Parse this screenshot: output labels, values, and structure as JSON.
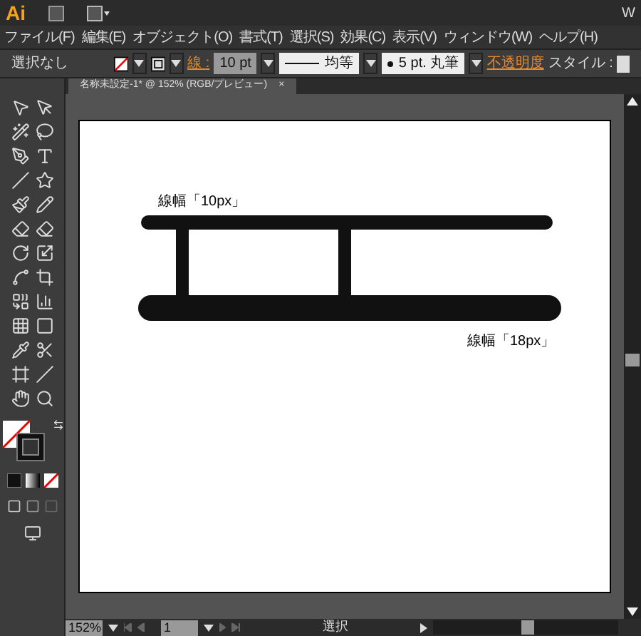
{
  "app": {
    "logo": "Ai",
    "cut_text": "W"
  },
  "menu": [
    "ファイル(F)",
    "編集(E)",
    "オブジェクト(O)",
    "書式(T)",
    "選択(S)",
    "効果(C)",
    "表示(V)",
    "ウィンドウ(W)",
    "ヘルプ(H)"
  ],
  "control_bar": {
    "selection": "選択なし",
    "stroke_label": "線 :",
    "stroke_weight": "10 pt",
    "profile": "均等",
    "brush": "5 pt. 丸筆",
    "opacity": "不透明度",
    "style_label": "スタイル :"
  },
  "document_tab": {
    "title": "名称未設定-1* @ 152% (RGB/プレビュー)",
    "close": "×"
  },
  "artboard": {
    "labels": [
      {
        "text": "線幅「10px」"
      },
      {
        "text": "線幅「18px」"
      }
    ]
  },
  "status_bar": {
    "zoom": "152%",
    "page": "1",
    "status": "選択"
  }
}
